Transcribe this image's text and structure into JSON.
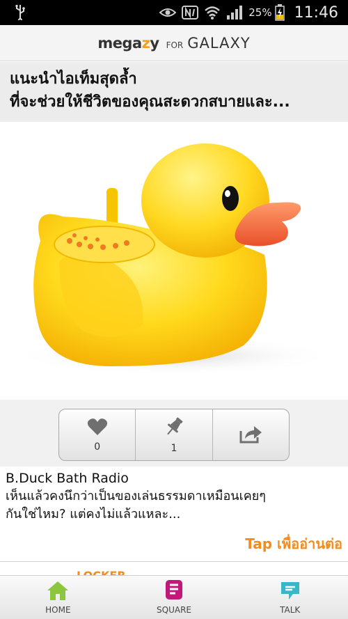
{
  "status_bar": {
    "battery_percent": "25%",
    "time": "11:46"
  },
  "app_header": {
    "brand_mega": "mega",
    "brand_z": "z",
    "brand_y": "y",
    "brand_for": "FOR",
    "brand_galaxy": "GALAXY"
  },
  "article": {
    "title_line1": "แนะนำไอเท็มสุดล้ำ",
    "title_line2": "ที่จะช่วยให้ชีวิตของคุณสะดวกสบายและ...",
    "actions": {
      "like_count": "0",
      "pin_count": "1"
    },
    "product_name": "B.Duck Bath Radio",
    "desc_line1": "เห็นแล้วคงนึกว่าเป็นของเล่นธรรมดาเหมือนเคยๆ",
    "desc_line2": "กันใช่ไหม? แต่คงไม่แล้วแหละ...",
    "tap_label": "Tap เพื่ออ่านต่อ",
    "next_section": "LOCKER"
  },
  "bottom_nav": {
    "items": [
      {
        "label": "HOME",
        "icon": "home-icon",
        "color": "#8cc63f"
      },
      {
        "label": "SQUARE",
        "icon": "square-icon",
        "color": "#c2187a"
      },
      {
        "label": "TALK",
        "icon": "talk-icon",
        "color": "#37b8c8"
      }
    ]
  },
  "colors": {
    "accent_orange": "#f28c1e",
    "duck_yellow": "#ffd21a",
    "beak_orange": "#f26a3a"
  }
}
